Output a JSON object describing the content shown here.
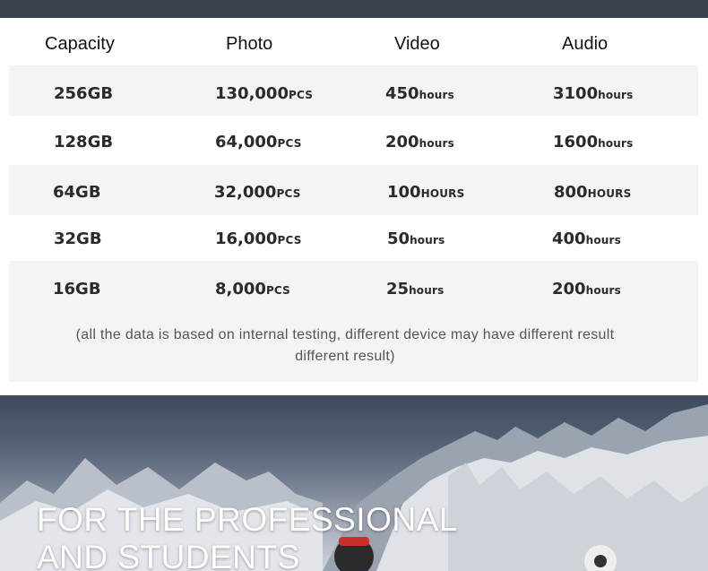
{
  "table": {
    "headers": [
      "Capacity",
      "Photo",
      "Video",
      "Audio"
    ],
    "rows": [
      {
        "capacity": "256GB",
        "photo": "130,000",
        "photo_unit": "PCS",
        "video": "450",
        "video_unit": "hours",
        "audio": "3100",
        "audio_unit": "hours"
      },
      {
        "capacity": "128GB",
        "photo": "64,000",
        "photo_unit": "PCS",
        "video": "200",
        "video_unit": "hours",
        "audio": "1600",
        "audio_unit": "hours"
      },
      {
        "capacity": "64GB",
        "photo": "32,000",
        "photo_unit": "PCS",
        "video": "100",
        "video_unit": "HOURS",
        "audio": "800",
        "audio_unit": "HOURS"
      },
      {
        "capacity": "32GB",
        "photo": "16,000",
        "photo_unit": "PCS",
        "video": "50",
        "video_unit": "hours",
        "audio": "400",
        "audio_unit": "hours"
      },
      {
        "capacity": "16GB",
        "photo": "8,000",
        "photo_unit": "PCS",
        "video": "25",
        "video_unit": "hours",
        "audio": "200",
        "audio_unit": "hours"
      }
    ],
    "note": "(all the data is based on internal testing, different device may have different result different result)"
  },
  "hero": {
    "title_line1": "FOR THE PROFESSIONAL",
    "title_line2": "AND STUDENTS"
  }
}
